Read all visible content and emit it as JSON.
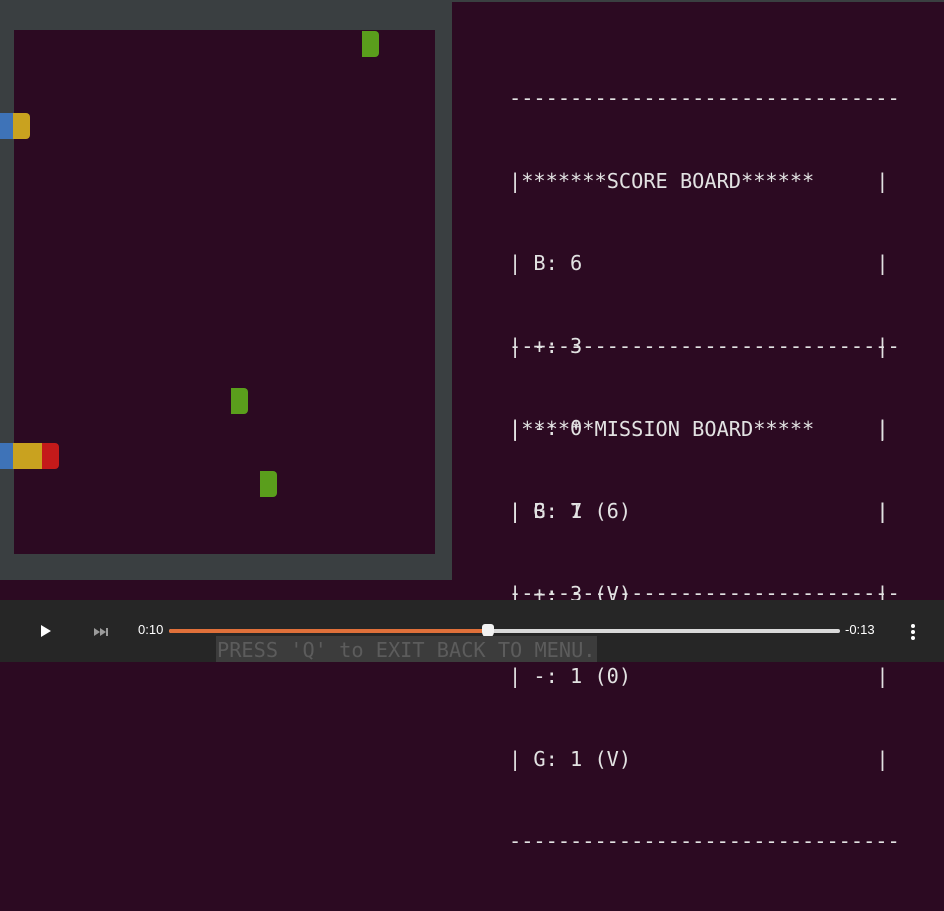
{
  "score_board": {
    "border": "--------------------------------",
    "title": "*******SCORE BOARD******",
    "rows": [
      "B: 6",
      "+: 3",
      "-: 0",
      "G: 1"
    ]
  },
  "mission_board": {
    "border": "--------------------------------",
    "title": "******MISSION BOARD*****",
    "rows": [
      "B: 7 (6)",
      "+: 3 (V)",
      "-: 1 (0)",
      "G: 1 (V)"
    ]
  },
  "player": {
    "elapsed": "0:10",
    "remaining": "-0:13",
    "progress": 0.476,
    "play_icon": "play-icon",
    "skip_icon": "skip-forward-icon",
    "menu_icon": "more-vertical-icon"
  },
  "caption": "PRESS 'Q' to EXIT BACK TO MENU.",
  "colors": {
    "terminal_bg": "#2c0a22",
    "wall": "#3a3f41",
    "food_green": "#5a9e1c",
    "snake_blue": "#3e73b8",
    "snake_yellow": "#c9a21f",
    "snake_red": "#c41a1a",
    "progress": "#e0703a"
  }
}
